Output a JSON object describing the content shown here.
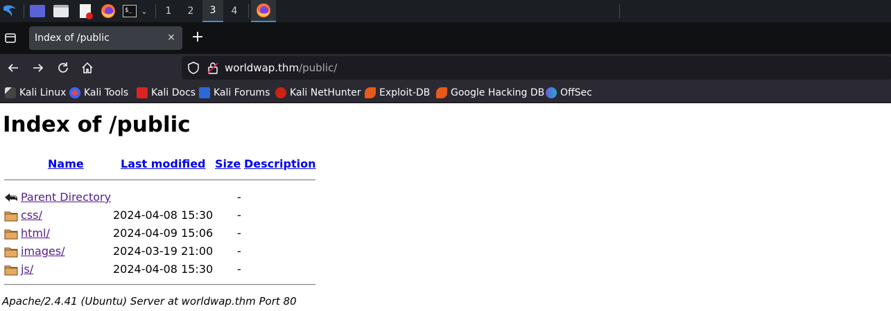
{
  "taskbar": {
    "workspaces": [
      "1",
      "2",
      "3",
      "4"
    ],
    "active_workspace": "3"
  },
  "tab": {
    "title": "Index of /public",
    "close": "×",
    "new_tab": "+"
  },
  "urlbar": {
    "host": "worldwap.thm",
    "path": "/public/"
  },
  "bookmarks": [
    "Kali Linux",
    "Kali Tools",
    "Kali Docs",
    "Kali Forums",
    "Kali NetHunter",
    "Exploit-DB",
    "Google Hacking DB",
    "OffSec"
  ],
  "page": {
    "heading": "Index of /public",
    "columns": {
      "name": "Name",
      "last_modified": "Last modified",
      "size": "Size",
      "description": "Description"
    },
    "rows": [
      {
        "name": "Parent Directory",
        "date": "",
        "size": "-",
        "icon": "back-icon"
      },
      {
        "name": "css/",
        "date": "2024-04-08 15:30",
        "size": "-",
        "icon": "folder-icon"
      },
      {
        "name": "html/",
        "date": "2024-04-09 15:06",
        "size": "-",
        "icon": "folder-icon"
      },
      {
        "name": "images/",
        "date": "2024-03-19 21:00",
        "size": "-",
        "icon": "folder-icon"
      },
      {
        "name": "js/",
        "date": "2024-04-08 15:30",
        "size": "-",
        "icon": "folder-icon"
      }
    ],
    "footer": "Apache/2.4.41 (Ubuntu) Server at worldwap.thm Port 80"
  },
  "colors": {
    "link": "#0000ee",
    "visited": "#551a8b",
    "accent": "#3d8ee8"
  }
}
